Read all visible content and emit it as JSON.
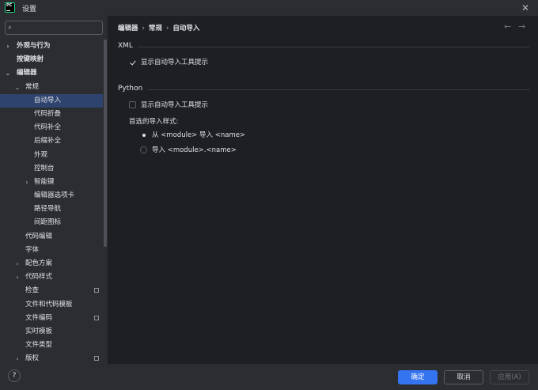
{
  "window": {
    "title": "设置",
    "logo_text": "PC",
    "close_icon": "close-icon"
  },
  "search": {
    "placeholder": "",
    "icon": "search-icon"
  },
  "sidebar": {
    "items": [
      {
        "label": "外观与行为",
        "level": 0,
        "arrow": "›",
        "bold": true,
        "selected": false,
        "badge": false
      },
      {
        "label": "按键映射",
        "level": 0,
        "arrow": "",
        "bold": true,
        "selected": false,
        "badge": false
      },
      {
        "label": "编辑器",
        "level": 0,
        "arrow": "⌄",
        "bold": true,
        "selected": false,
        "badge": false
      },
      {
        "label": "常规",
        "level": 1,
        "arrow": "⌄",
        "bold": false,
        "selected": false,
        "badge": false
      },
      {
        "label": "自动导入",
        "level": 2,
        "arrow": "",
        "bold": false,
        "selected": true,
        "badge": false
      },
      {
        "label": "代码折叠",
        "level": 2,
        "arrow": "",
        "bold": false,
        "selected": false,
        "badge": false
      },
      {
        "label": "代码补全",
        "level": 2,
        "arrow": "",
        "bold": false,
        "selected": false,
        "badge": false
      },
      {
        "label": "后缀补全",
        "level": 2,
        "arrow": "",
        "bold": false,
        "selected": false,
        "badge": false
      },
      {
        "label": "外观",
        "level": 2,
        "arrow": "",
        "bold": false,
        "selected": false,
        "badge": false
      },
      {
        "label": "控制台",
        "level": 2,
        "arrow": "",
        "bold": false,
        "selected": false,
        "badge": false
      },
      {
        "label": "智能键",
        "level": 2,
        "arrow": "›",
        "bold": false,
        "selected": false,
        "badge": false
      },
      {
        "label": "编辑器选项卡",
        "level": 2,
        "arrow": "",
        "bold": false,
        "selected": false,
        "badge": false
      },
      {
        "label": "路径导航",
        "level": 2,
        "arrow": "",
        "bold": false,
        "selected": false,
        "badge": false
      },
      {
        "label": "间距图标",
        "level": 2,
        "arrow": "",
        "bold": false,
        "selected": false,
        "badge": false
      },
      {
        "label": "代码编辑",
        "level": 1,
        "arrow": "",
        "bold": false,
        "selected": false,
        "badge": false
      },
      {
        "label": "字体",
        "level": 1,
        "arrow": "",
        "bold": false,
        "selected": false,
        "badge": false
      },
      {
        "label": "配色方案",
        "level": 1,
        "arrow": "›",
        "bold": false,
        "selected": false,
        "badge": false
      },
      {
        "label": "代码样式",
        "level": 1,
        "arrow": "›",
        "bold": false,
        "selected": false,
        "badge": false
      },
      {
        "label": "检查",
        "level": 1,
        "arrow": "",
        "bold": false,
        "selected": false,
        "badge": true
      },
      {
        "label": "文件和代码模板",
        "level": 1,
        "arrow": "",
        "bold": false,
        "selected": false,
        "badge": false
      },
      {
        "label": "文件编码",
        "level": 1,
        "arrow": "",
        "bold": false,
        "selected": false,
        "badge": true
      },
      {
        "label": "实时模板",
        "level": 1,
        "arrow": "",
        "bold": false,
        "selected": false,
        "badge": false
      },
      {
        "label": "文件类型",
        "level": 1,
        "arrow": "",
        "bold": false,
        "selected": false,
        "badge": false
      },
      {
        "label": "版权",
        "level": 1,
        "arrow": "›",
        "bold": false,
        "selected": false,
        "badge": true
      }
    ]
  },
  "breadcrumb": [
    "编辑器",
    "常规",
    "自动导入"
  ],
  "nav": {
    "back": "←",
    "forward": "→"
  },
  "xml_section": {
    "title": "XML",
    "show_tooltip": {
      "label": "显示自动导入工具提示",
      "checked": true
    }
  },
  "python_section": {
    "title": "Python",
    "show_tooltip": {
      "label": "显示自动导入工具提示",
      "checked": false
    },
    "preferred_style_label": "首选的导入样式:",
    "options": [
      {
        "label": "从 <module> 导入 <name>",
        "selected": true
      },
      {
        "label": "导入 <module>.<name>",
        "selected": false
      }
    ]
  },
  "footer": {
    "help": "?",
    "ok": "确定",
    "cancel": "取消",
    "apply": "应用(A)"
  },
  "colors": {
    "accent": "#3574f0",
    "selection": "#2e436e",
    "panel_bg": "#1e1f22",
    "sidebar_bg": "#2b2d30"
  }
}
